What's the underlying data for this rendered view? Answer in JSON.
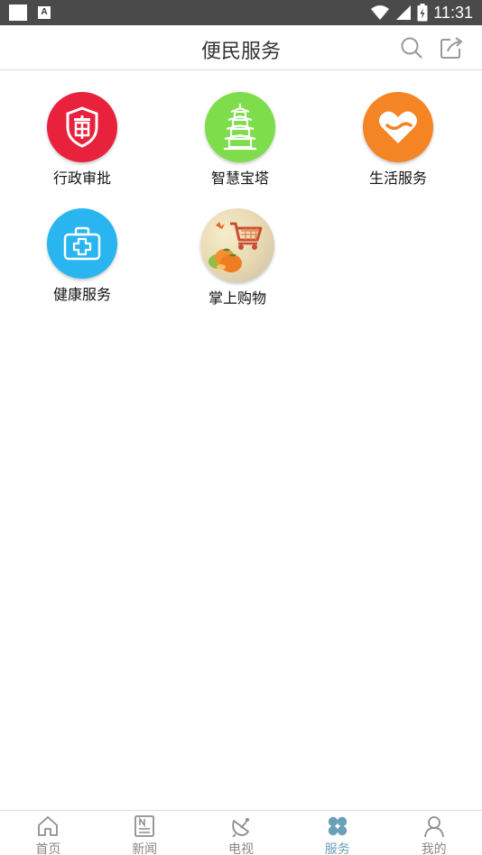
{
  "status_bar": {
    "time": "11:31",
    "notification_badge": "A",
    "icons": [
      "wifi-icon",
      "signal-icon",
      "battery-icon"
    ]
  },
  "header": {
    "title": "便民服务",
    "icons": [
      "search-icon",
      "share-icon"
    ]
  },
  "services": [
    {
      "label": "行政审批",
      "icon": "approval-seal-icon",
      "color": "#e8213c"
    },
    {
      "label": "智慧宝塔",
      "icon": "pagoda-icon",
      "color": "#7ddd4a"
    },
    {
      "label": "生活服务",
      "icon": "heart-icon",
      "color": "#f58424"
    },
    {
      "label": "健康服务",
      "icon": "medical-kit-icon",
      "color": "#29b6f0"
    },
    {
      "label": "掌上购物",
      "icon": "shopping-cart-icon",
      "color": "#e6d7b0"
    }
  ],
  "tab_bar": {
    "items": [
      {
        "label": "首页",
        "icon": "home-icon",
        "active": false
      },
      {
        "label": "新闻",
        "icon": "news-icon",
        "active": false
      },
      {
        "label": "电视",
        "icon": "satellite-dish-icon",
        "active": false
      },
      {
        "label": "服务",
        "icon": "services-grid-icon",
        "active": true
      },
      {
        "label": "我的",
        "icon": "profile-icon",
        "active": false
      }
    ],
    "active_color": "#6a9fb8",
    "inactive_color": "#888888"
  }
}
